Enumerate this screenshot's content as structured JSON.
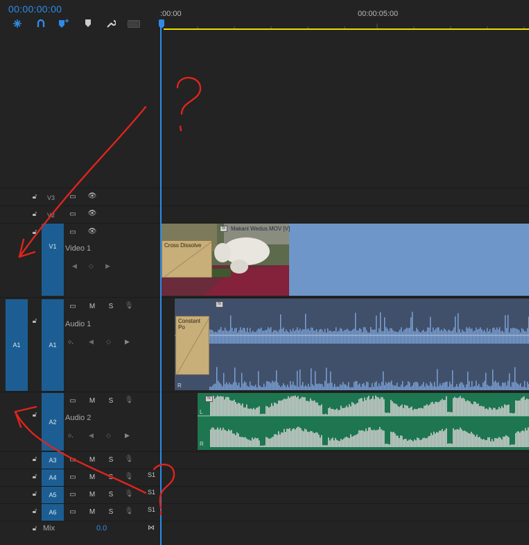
{
  "header": {
    "timecode": "00:00:00:00",
    "tools": [
      {
        "icon": "snap-icon"
      },
      {
        "icon": "linked-selection-icon"
      },
      {
        "icon": "add-marker-icon"
      },
      {
        "icon": "marker-icon"
      },
      {
        "icon": "wrench-icon"
      },
      {
        "icon": "captions-icon",
        "label": "CC"
      }
    ]
  },
  "ruler": {
    "labels": [
      ":00:00",
      "00:00:05:00"
    ]
  },
  "tracks": {
    "v3": {
      "name": "V3"
    },
    "v2": {
      "name": "V2"
    },
    "v1": {
      "target": "V1",
      "name": "Video 1"
    },
    "a1": {
      "source": "A1",
      "target": "A1",
      "name": "Audio 1",
      "m": "M",
      "s": "S"
    },
    "a2": {
      "target": "A2",
      "name": "Audio 2",
      "m": "M",
      "s": "S"
    },
    "a3": {
      "target": "A3",
      "m": "M",
      "s": "S"
    },
    "a4": {
      "target": "A4",
      "m": "M",
      "s": "S",
      "side": "S1"
    },
    "a5": {
      "target": "A5",
      "m": "M",
      "s": "S",
      "side": "S1"
    },
    "a6": {
      "target": "A6",
      "m": "M",
      "s": "S",
      "side": "S1"
    },
    "mix": {
      "label": "Mix",
      "value": "0.0"
    }
  },
  "clips": {
    "video": {
      "name": "Makani Wedus.MOV [V]",
      "fx": "fx",
      "transition": "Cross Dissolve"
    },
    "audio1": {
      "fx": "fx",
      "transition": "Constant Po",
      "r": "R"
    },
    "audio2": {
      "fx": "fx",
      "r": "R",
      "l": "L"
    }
  },
  "annotations": {
    "mark": "?",
    "color": "#e0241d"
  },
  "colors": {
    "accent": "#2d8ceb",
    "track_target": "#1c5e93",
    "video_clip": "#6f96c8",
    "audio_clip": "#41506a",
    "audio2_clip": "#1d7650",
    "work_area": "#e8e000"
  }
}
